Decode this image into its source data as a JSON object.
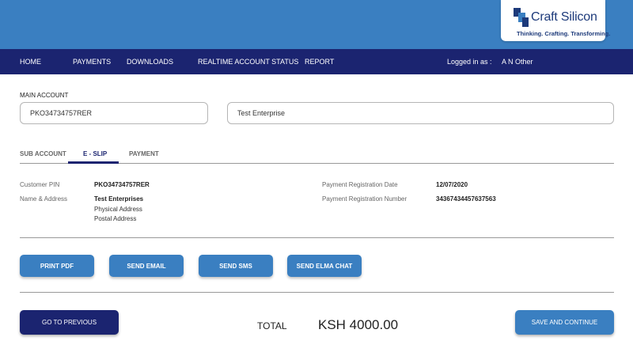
{
  "brand": {
    "name": "Craft Silicon",
    "tagline": "Thinking. Crafting. Transforming.",
    "colors": {
      "banner": "#3a7fc1",
      "navbar": "#1b2470",
      "logo": "#1d3a7a"
    }
  },
  "nav": {
    "items": [
      "HOME",
      "PAYMENTS",
      "DOWNLOADS",
      "REALTIME ACCOUNT STATUS",
      "REPORT"
    ],
    "logged_in_label": "Logged in as :",
    "user_name": "A N Other"
  },
  "main_account": {
    "label": "MAIN ACCOUNT",
    "account_number": "PKO34734757RER",
    "account_name": "Test Enterprise"
  },
  "tabs": {
    "items": [
      "SUB ACCOUNT",
      "E - SLIP",
      "PAYMENT"
    ],
    "active": "E - SLIP"
  },
  "slip": {
    "customer_pin_label": "Customer PIN",
    "customer_pin": "PKO34734757RER",
    "name_address_label": "Name & Address",
    "name": "Test Enterprises",
    "physical_address": "Physical Address",
    "postal_address": "Postal Address",
    "reg_date_label": "Payment Registration Date",
    "reg_date": "12/07/2020",
    "reg_number_label": "Payment Registration Number",
    "reg_number": "34367434457637563"
  },
  "actions": {
    "print_pdf": "PRINT PDF",
    "send_email": "SEND EMAIL",
    "send_sms": "SEND SMS",
    "send_elma_chat": "SEND ELMA CHAT"
  },
  "footer": {
    "previous": "GO TO PREVIOUS",
    "total_label": "TOTAL",
    "total_value": "KSH 4000.00",
    "save": "SAVE AND CONTINUE"
  }
}
